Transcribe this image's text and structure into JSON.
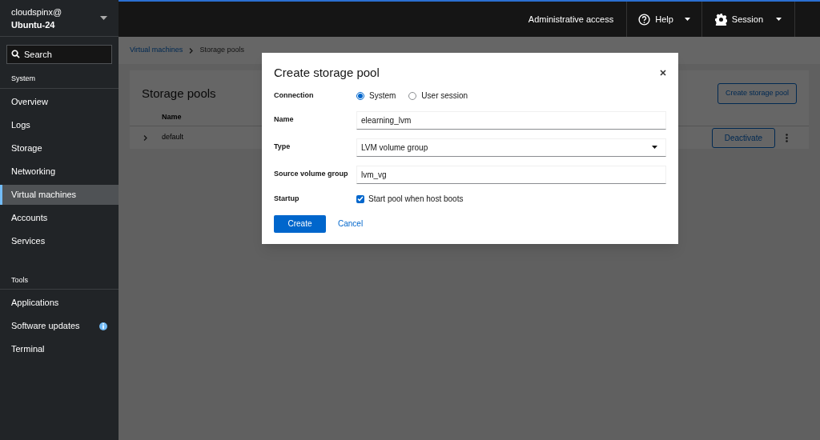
{
  "host": {
    "user": "cloudspinx@",
    "name": "Ubuntu-24"
  },
  "search": {
    "placeholder": "Search"
  },
  "nav": [
    {
      "heading": "System",
      "items": [
        {
          "label": "Overview",
          "selected": false,
          "notice": false
        },
        {
          "label": "Logs",
          "selected": false,
          "notice": false
        },
        {
          "label": "Storage",
          "selected": false,
          "notice": false
        },
        {
          "label": "Networking",
          "selected": false,
          "notice": false
        },
        {
          "label": "Virtual machines",
          "selected": true,
          "notice": false
        },
        {
          "label": "Accounts",
          "selected": false,
          "notice": false
        },
        {
          "label": "Services",
          "selected": false,
          "notice": false
        }
      ]
    },
    {
      "heading": "Tools",
      "items": [
        {
          "label": "Applications",
          "selected": false,
          "notice": false
        },
        {
          "label": "Software updates",
          "selected": false,
          "notice": true
        },
        {
          "label": "Terminal",
          "selected": false,
          "notice": false
        }
      ]
    }
  ],
  "header": {
    "admin": "Administrative access",
    "help": "Help",
    "session": "Session"
  },
  "breadcrumb": [
    {
      "label": "Virtual machines",
      "link": true
    },
    {
      "label": "Storage pools",
      "link": false
    }
  ],
  "page": {
    "title": "Storage pools",
    "create_button": "Create storage pool",
    "columns": [
      "Name"
    ],
    "rows": [
      {
        "name": "default",
        "action": "Deactivate"
      }
    ]
  },
  "dialog": {
    "title": "Create storage pool",
    "fields": [
      {
        "kind": "radio",
        "label": "Connection",
        "options": [
          {
            "label": "System",
            "selected": true
          },
          {
            "label": "User session",
            "selected": false
          }
        ]
      },
      {
        "kind": "text",
        "label": "Name",
        "value": "elearning_lvm"
      },
      {
        "kind": "select",
        "label": "Type",
        "value": "LVM volume group"
      },
      {
        "kind": "text",
        "label": "Source volume group",
        "value": "lvm_vg"
      },
      {
        "kind": "checkbox",
        "label": "Startup",
        "text": "Start pool when host boots",
        "checked": true
      }
    ],
    "primary": "Create",
    "cancel": "Cancel"
  }
}
